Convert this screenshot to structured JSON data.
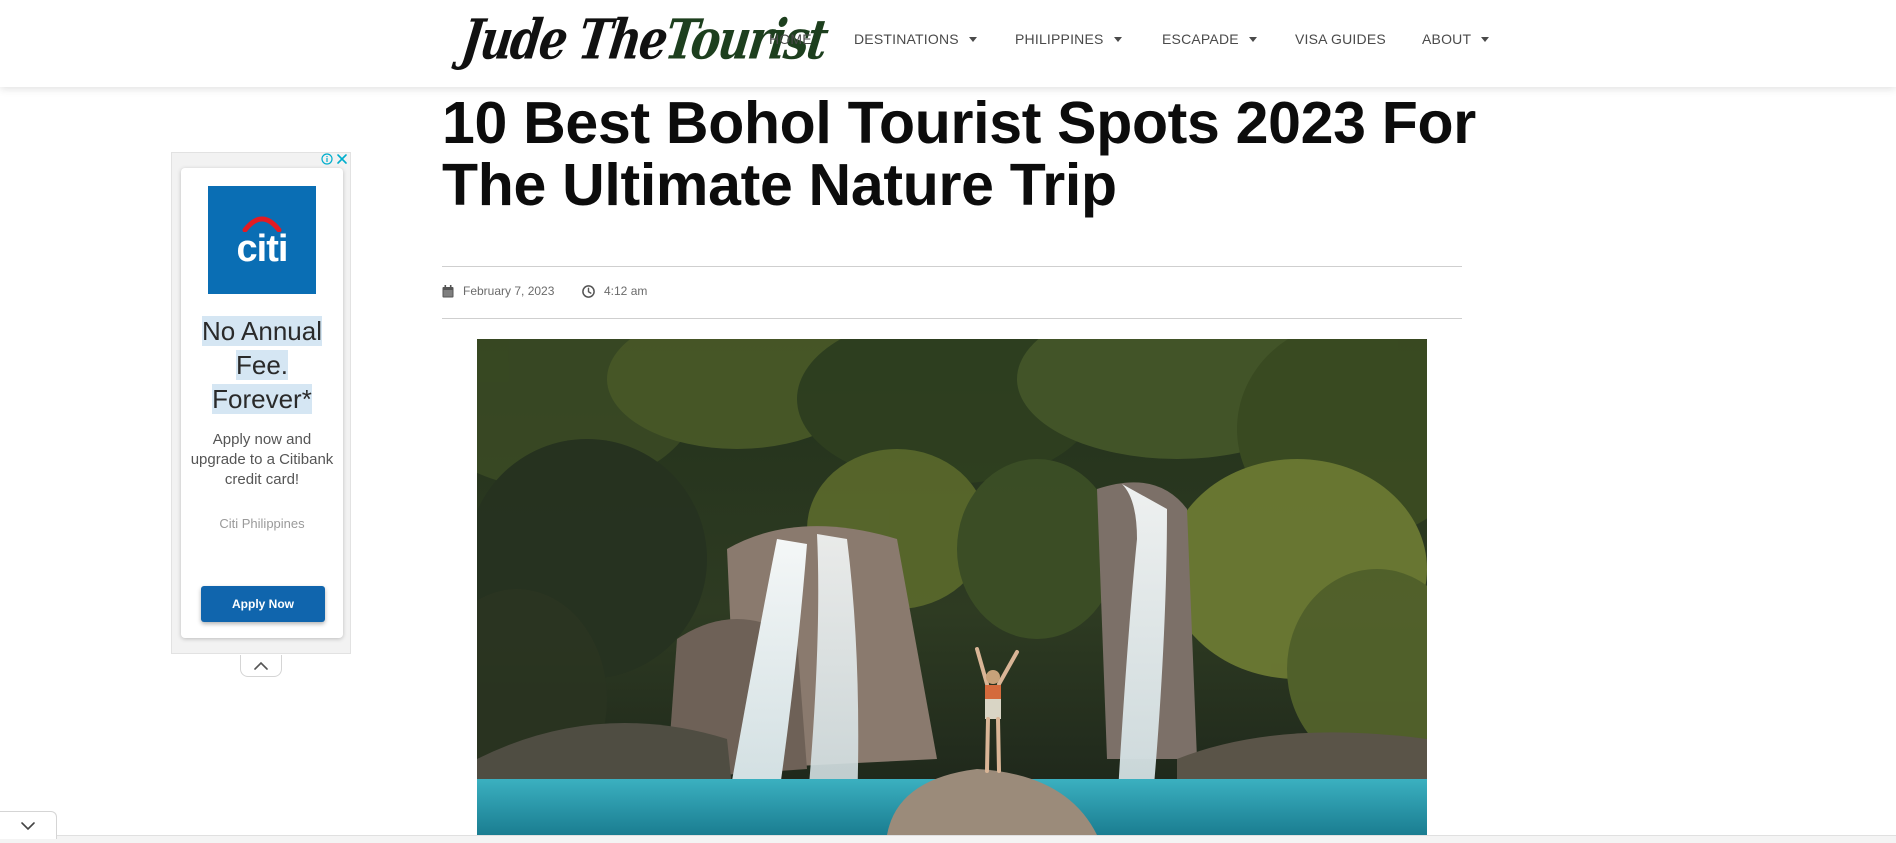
{
  "header": {
    "logo": {
      "part1": "Jude The ",
      "part2": "Tourist"
    },
    "nav": [
      {
        "label": "HOME",
        "dropdown": false
      },
      {
        "label": "DESTINATIONS",
        "dropdown": true
      },
      {
        "label": "PHILIPPINES",
        "dropdown": true
      },
      {
        "label": "ESCAPADE",
        "dropdown": true
      },
      {
        "label": "VISA GUIDES",
        "dropdown": false
      },
      {
        "label": "ABOUT",
        "dropdown": true
      }
    ]
  },
  "article": {
    "title": "10 Best Bohol Tourist Spots 2023 For The Ultimate Nature Trip",
    "date": "February 7, 2023",
    "time": "4:12 am",
    "icons": {
      "date": "calendar-icon",
      "time": "clock-icon"
    }
  },
  "ad": {
    "brand_logo": "citi",
    "headline": [
      "No Annual",
      "Fee.",
      "Forever*"
    ],
    "body": "Apply now and upgrade to a Citibank credit card!",
    "advertiser": "Citi Philippines",
    "cta": "Apply Now",
    "icons": {
      "info": "info-icon",
      "close": "close-icon",
      "collapse": "chevron-up-icon"
    },
    "colors": {
      "brand": "#0a6eb4",
      "cta": "#1065ad",
      "highlight": "#d5e6f3"
    }
  },
  "page": {
    "bottom_toggle_icon": "chevron-down-icon"
  },
  "colors": {
    "logo_accent": "#1d3f1e",
    "title": "#0c0c0c",
    "nav_text": "#4a4a4a"
  }
}
